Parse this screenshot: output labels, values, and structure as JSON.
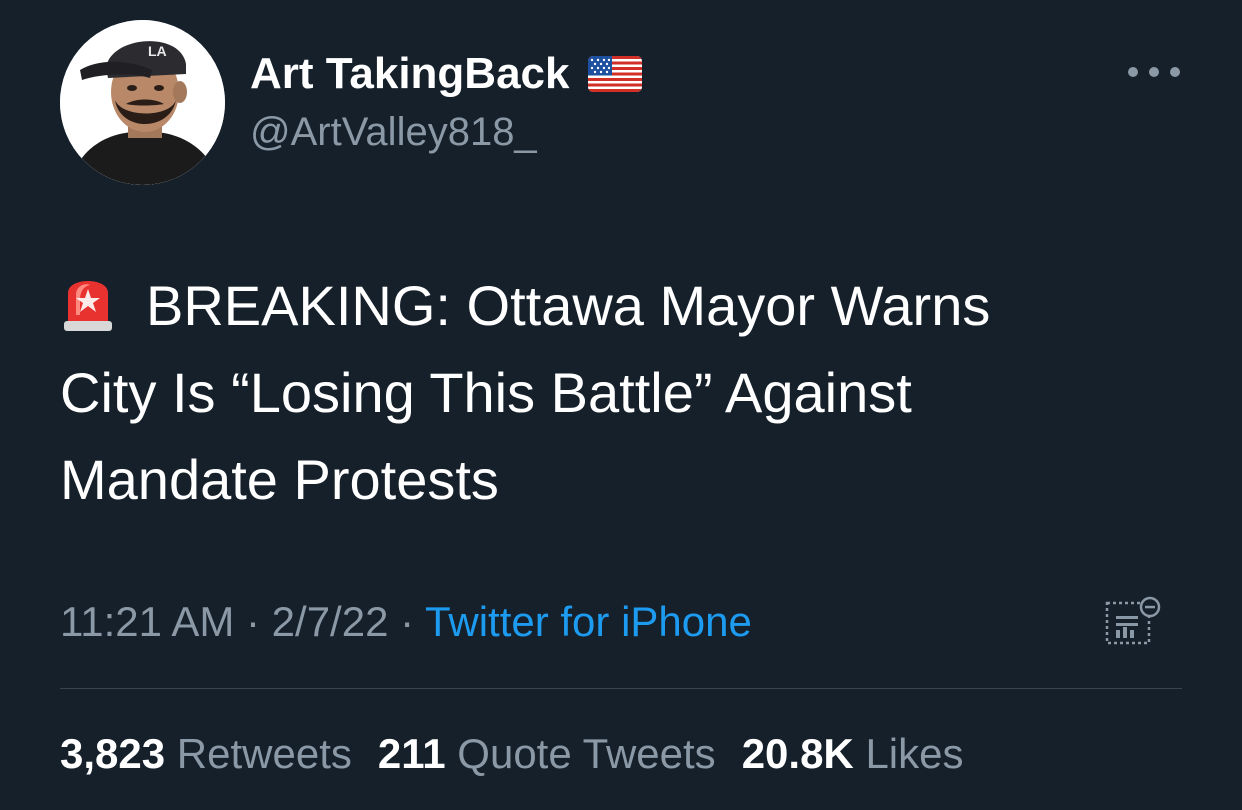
{
  "author": {
    "display_name": "Art TakingBack",
    "handle": "@ArtValley818_",
    "avatar_icon": "profile-photo",
    "flag_icon": "us-flag-emoji"
  },
  "tweet": {
    "emoji_icon": "police-siren-emoji",
    "lines": [
      "BREAKING: Ottawa Mayor Warns",
      "City Is “Losing This Battle” Against",
      "Mandate Protests"
    ]
  },
  "meta": {
    "time": "11:21 AM",
    "separator": " · ",
    "date": "2/7/22",
    "source": "Twitter for iPhone",
    "analytics_icon": "analytics-icon"
  },
  "stats": {
    "retweets_count": "3,823",
    "retweets_label": "Retweets",
    "quotes_count": "211",
    "quotes_label": "Quote Tweets",
    "likes_count": "20.8K",
    "likes_label": "Likes"
  },
  "colors": {
    "background": "#15202b",
    "primary_text": "#ffffff",
    "secondary_text": "#8b98a5",
    "accent": "#1d9bf0",
    "divider": "#38444d"
  }
}
